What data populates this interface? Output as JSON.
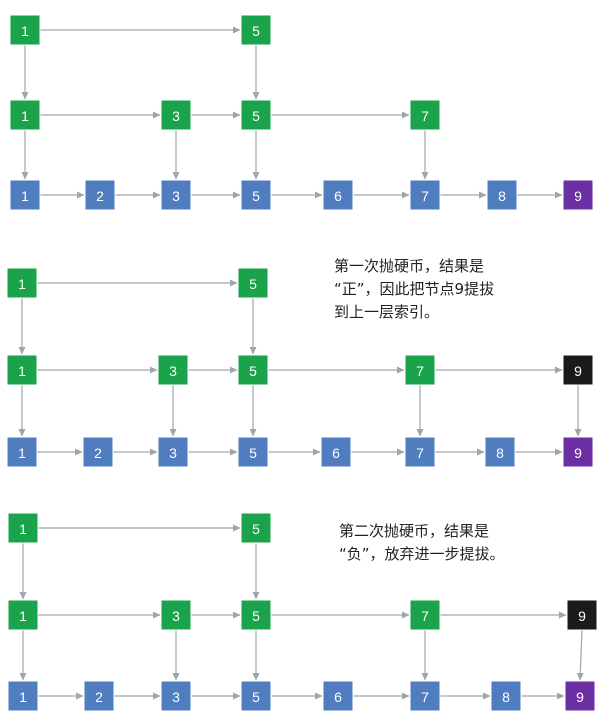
{
  "colors": {
    "index": "#1aa34a",
    "base": "#4f7dbf",
    "promoted": "#1a1a1a",
    "target": "#6b2ea3",
    "edge": "#9ea6ad",
    "node_text": "#ffffff"
  },
  "captions": [
    "第一次抛硬币，结果是\n“正”，因此把节点9提拔\n到上一层索引。",
    "第二次抛硬币，结果是\n“负”，放弃进一步提拔。"
  ],
  "panels": [
    {
      "rows": [
        {
          "nodes": [
            {
              "label": "1",
              "kind": "index"
            },
            {
              "label": "5",
              "kind": "index"
            }
          ]
        },
        {
          "nodes": [
            {
              "label": "1",
              "kind": "index"
            },
            {
              "label": "3",
              "kind": "index"
            },
            {
              "label": "5",
              "kind": "index"
            },
            {
              "label": "7",
              "kind": "index"
            }
          ]
        },
        {
          "nodes": [
            {
              "label": "1",
              "kind": "base"
            },
            {
              "label": "2",
              "kind": "base"
            },
            {
              "label": "3",
              "kind": "base"
            },
            {
              "label": "5",
              "kind": "base"
            },
            {
              "label": "6",
              "kind": "base"
            },
            {
              "label": "7",
              "kind": "base"
            },
            {
              "label": "8",
              "kind": "base"
            },
            {
              "label": "9",
              "kind": "target"
            }
          ]
        }
      ]
    },
    {
      "rows": [
        {
          "nodes": [
            {
              "label": "1",
              "kind": "index"
            },
            {
              "label": "5",
              "kind": "index"
            }
          ]
        },
        {
          "nodes": [
            {
              "label": "1",
              "kind": "index"
            },
            {
              "label": "3",
              "kind": "index"
            },
            {
              "label": "5",
              "kind": "index"
            },
            {
              "label": "7",
              "kind": "index"
            },
            {
              "label": "9",
              "kind": "promoted"
            }
          ]
        },
        {
          "nodes": [
            {
              "label": "1",
              "kind": "base"
            },
            {
              "label": "2",
              "kind": "base"
            },
            {
              "label": "3",
              "kind": "base"
            },
            {
              "label": "5",
              "kind": "base"
            },
            {
              "label": "6",
              "kind": "base"
            },
            {
              "label": "7",
              "kind": "base"
            },
            {
              "label": "8",
              "kind": "base"
            },
            {
              "label": "9",
              "kind": "target"
            }
          ]
        }
      ]
    },
    {
      "rows": [
        {
          "nodes": [
            {
              "label": "1",
              "kind": "index"
            },
            {
              "label": "5",
              "kind": "index"
            }
          ]
        },
        {
          "nodes": [
            {
              "label": "1",
              "kind": "index"
            },
            {
              "label": "3",
              "kind": "index"
            },
            {
              "label": "5",
              "kind": "index"
            },
            {
              "label": "7",
              "kind": "index"
            },
            {
              "label": "9",
              "kind": "promoted"
            }
          ]
        },
        {
          "nodes": [
            {
              "label": "1",
              "kind": "base"
            },
            {
              "label": "2",
              "kind": "base"
            },
            {
              "label": "3",
              "kind": "base"
            },
            {
              "label": "5",
              "kind": "base"
            },
            {
              "label": "6",
              "kind": "base"
            },
            {
              "label": "7",
              "kind": "base"
            },
            {
              "label": "8",
              "kind": "base"
            },
            {
              "label": "9",
              "kind": "target"
            }
          ]
        }
      ]
    }
  ]
}
